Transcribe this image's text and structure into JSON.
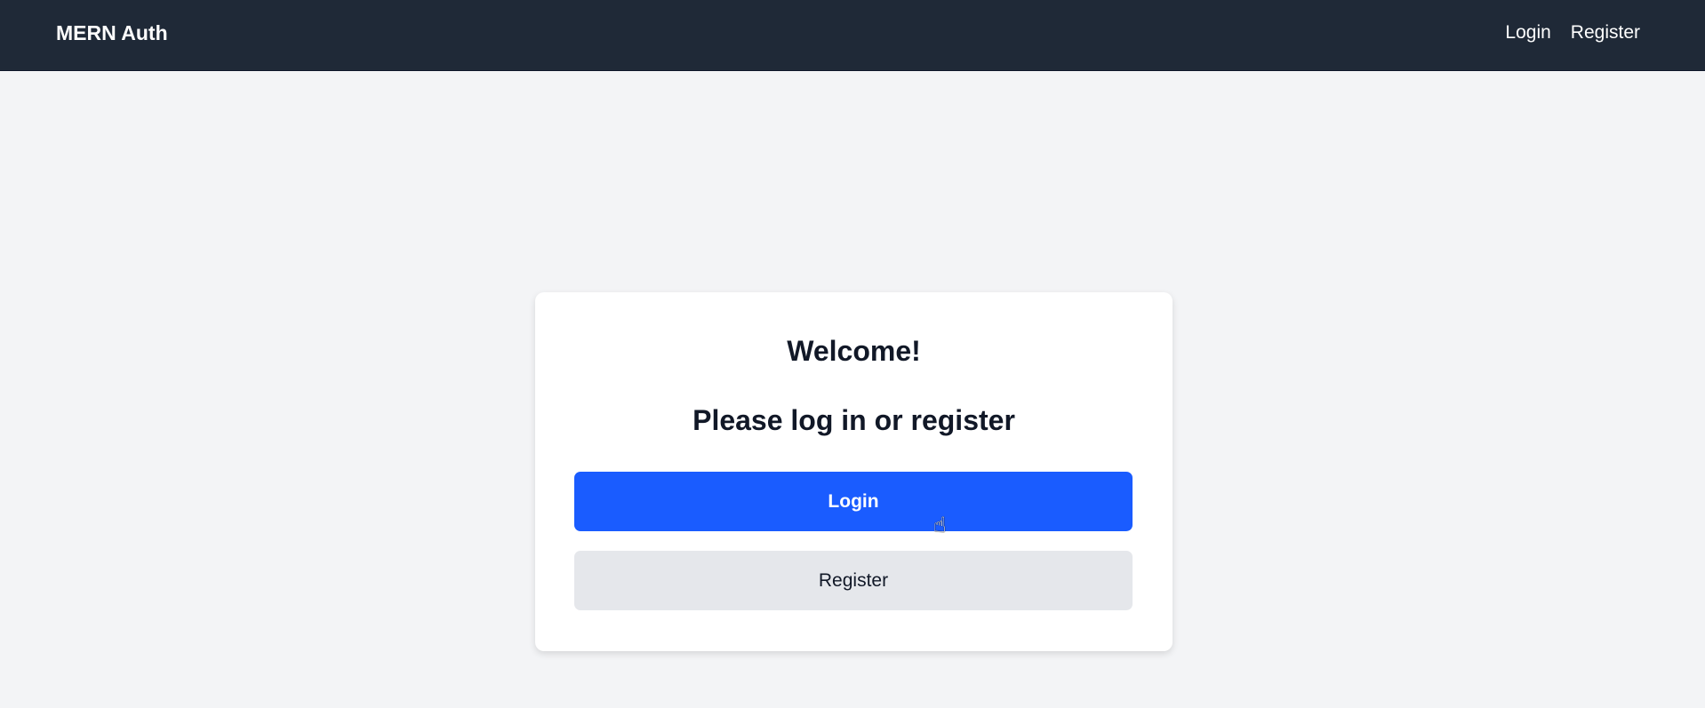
{
  "navbar": {
    "brand": "MERN Auth",
    "links": [
      "Login",
      "Register"
    ]
  },
  "card": {
    "title": "Welcome!",
    "subtitle": "Please log in or register",
    "login_label": "Login",
    "register_label": "Register"
  },
  "colors": {
    "navbar": "#1f2937",
    "primary": "#1a5cff",
    "secondary": "#e5e7eb",
    "background": "#f3f4f6"
  }
}
